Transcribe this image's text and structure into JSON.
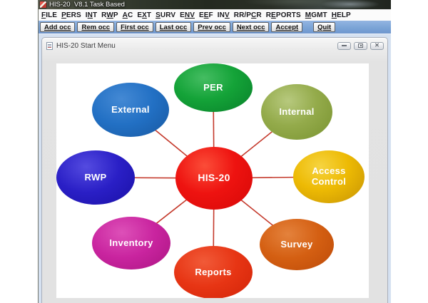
{
  "window": {
    "title": "HIS-20  V8.1 Task Based"
  },
  "menu": {
    "items": [
      {
        "label": "FILE",
        "pre": "",
        "accel": "F",
        "post": "ILE"
      },
      {
        "label": "PERS",
        "pre": "",
        "accel": "P",
        "post": "ERS"
      },
      {
        "label": "INT",
        "pre": "I",
        "accel": "N",
        "post": "T"
      },
      {
        "label": "RWP",
        "pre": "R",
        "accel": "W",
        "post": "P"
      },
      {
        "label": "AC",
        "pre": "",
        "accel": "A",
        "post": "C"
      },
      {
        "label": "EXT",
        "pre": "E",
        "accel": "X",
        "post": "T"
      },
      {
        "label": "SURV",
        "pre": "",
        "accel": "S",
        "post": "URV"
      },
      {
        "label": "ENV",
        "pre": "E",
        "accel": "NV",
        "post": ""
      },
      {
        "label": "EEF",
        "pre": "E",
        "accel": "E",
        "post": "F"
      },
      {
        "label": "INV",
        "pre": "IN",
        "accel": "V",
        "post": ""
      },
      {
        "label": "RR/PCR",
        "pre": "RR/P",
        "accel": "C",
        "post": "R"
      },
      {
        "label": "REPORTS",
        "pre": "R",
        "accel": "E",
        "post": "PORTS"
      },
      {
        "label": "MGMT",
        "pre": "",
        "accel": "M",
        "post": "GMT"
      },
      {
        "label": "HELP",
        "pre": "",
        "accel": "H",
        "post": "ELP"
      }
    ]
  },
  "toolbar": {
    "buttons": [
      "Add occ",
      "Rem occ",
      "First occ",
      "Last occ",
      "Prev occ",
      "Next occ",
      "Accept",
      "Quit"
    ]
  },
  "child_window": {
    "title": "HIS-20 Start Menu",
    "controls": [
      {
        "name": "minimize"
      },
      {
        "name": "restore"
      },
      {
        "name": "close"
      }
    ]
  },
  "diagram": {
    "center": {
      "label": "HIS-20",
      "color": "#ee1310"
    },
    "nodes": [
      {
        "label": "PER",
        "color": "#14a338"
      },
      {
        "label": "Internal",
        "color": "#94ab4b"
      },
      {
        "label": "Access Control",
        "color": "#edba04"
      },
      {
        "label": "Survey",
        "color": "#d45f12"
      },
      {
        "label": "Reports",
        "color": "#e73514"
      },
      {
        "label": "Inventory",
        "color": "#c9249f"
      },
      {
        "label": "RWP",
        "color": "#2a1fc6"
      },
      {
        "label": "External",
        "color": "#2270c4"
      }
    ],
    "connector_color": "#c4392b",
    "text_color": "#ffffff",
    "background": "#ffffff"
  }
}
